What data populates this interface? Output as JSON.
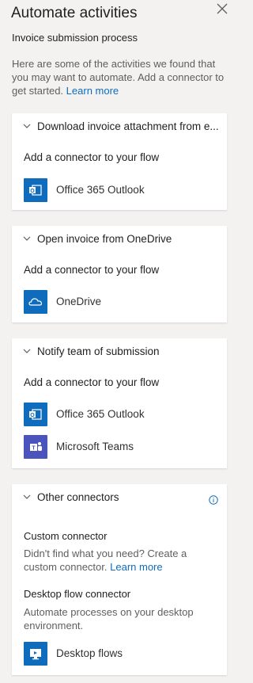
{
  "panel": {
    "title": "Automate activities",
    "subtitle": "Invoice submission process",
    "intro": "Here are some of the activities we found that you may want to automate. Add a connector to get started.",
    "intro_link": "Learn more"
  },
  "cards": [
    {
      "title": "Download invoice attachment from e...",
      "add_label": "Add a connector to your flow",
      "connectors": [
        {
          "label": "Office 365 Outlook",
          "icon": "outlook-icon",
          "color": "#0f6cbd"
        }
      ]
    },
    {
      "title": "Open invoice from OneDrive",
      "add_label": "Add a connector to your flow",
      "connectors": [
        {
          "label": "OneDrive",
          "icon": "onedrive-icon",
          "color": "#0f6cbd"
        }
      ]
    },
    {
      "title": "Notify team of submission",
      "add_label": "Add a connector to your flow",
      "connectors": [
        {
          "label": "Office 365 Outlook",
          "icon": "outlook-icon",
          "color": "#0f6cbd"
        },
        {
          "label": "Microsoft Teams",
          "icon": "teams-icon",
          "color": "#4b53bc"
        }
      ]
    }
  ],
  "other": {
    "title": "Other connectors",
    "custom_title": "Custom connector",
    "custom_text": "Didn't find what you need? Create a custom connector.",
    "custom_link": "Learn more",
    "desktop_title": "Desktop flow connector",
    "desktop_text": "Automate processes on your desktop environment.",
    "desktop_connector": {
      "label": "Desktop flows",
      "icon": "desktop-flows-icon",
      "color": "#0f6cbd"
    }
  }
}
